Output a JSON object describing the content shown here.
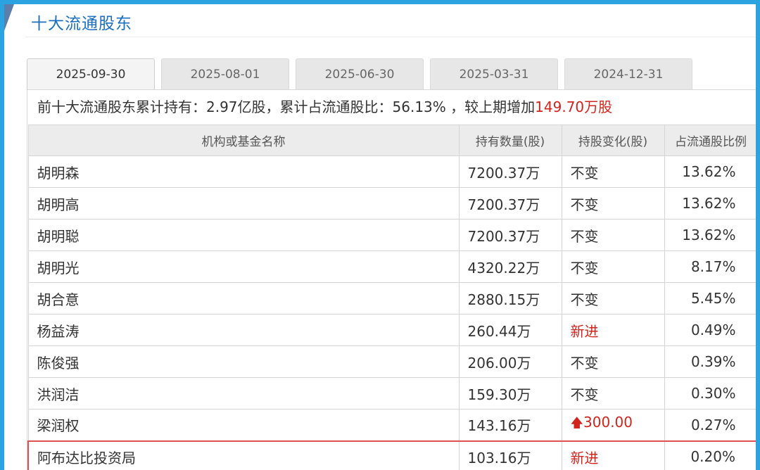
{
  "title": "十大流通股东",
  "tabs": [
    {
      "label": "2025-09-30",
      "active": true
    },
    {
      "label": "2025-08-01",
      "active": false
    },
    {
      "label": "2025-06-30",
      "active": false
    },
    {
      "label": "2025-03-31",
      "active": false
    },
    {
      "label": "2024-12-31",
      "active": false
    }
  ],
  "summary": {
    "prefix": "前十大流通股东累计持有：2.97亿股，累计占流通股比：56.13% ，较上期增加",
    "change": "149.70万股"
  },
  "table": {
    "headers": [
      "机构或基金名称",
      "持有数量(股)",
      "持股变化(股)",
      "占流通股比例"
    ],
    "rows": [
      {
        "name": "胡明森",
        "qty": "7200.37万",
        "change": "不变",
        "pct": "13.62%"
      },
      {
        "name": "胡明高",
        "qty": "7200.37万",
        "change": "不变",
        "pct": "13.62%"
      },
      {
        "name": "胡明聪",
        "qty": "7200.37万",
        "change": "不变",
        "pct": "13.62%"
      },
      {
        "name": "胡明光",
        "qty": "4320.22万",
        "change": "不变",
        "pct": "8.17%"
      },
      {
        "name": "胡合意",
        "qty": "2880.15万",
        "change": "不变",
        "pct": "5.45%"
      },
      {
        "name": "杨益涛",
        "qty": "260.44万",
        "change": "新进",
        "pct": "0.49%"
      },
      {
        "name": "陈俊强",
        "qty": "206.00万",
        "change": "不变",
        "pct": "0.39%"
      },
      {
        "name": "洪润洁",
        "qty": "159.30万",
        "change": "不变",
        "pct": "0.30%"
      },
      {
        "name": "梁润权",
        "qty": "143.16万",
        "change": "300.00",
        "pct": "0.27%"
      },
      {
        "name": "阿布达比投资局",
        "qty": "103.16万",
        "change": "新进",
        "pct": "0.20%"
      }
    ]
  },
  "icons": {
    "increase": "up-arrow-icon"
  },
  "colors": {
    "accent": "#1b6fc0",
    "positive": "#d1241c",
    "frame": "#2aa3e0",
    "highlight_border": "#e05050"
  }
}
